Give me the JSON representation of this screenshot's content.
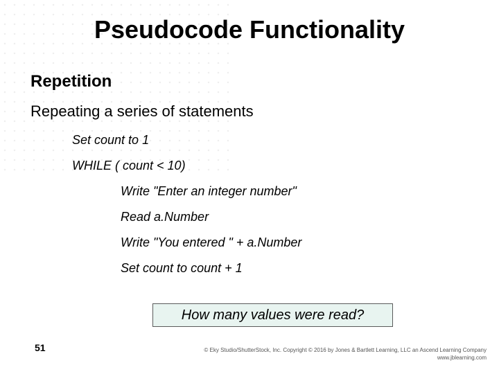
{
  "slide": {
    "title": "Pseudocode Functionality",
    "subhead": "Repetition",
    "lead": "Repeating a series of statements",
    "code": {
      "l1": "Set count to 1",
      "l2": "WHILE ( count < 10)",
      "l3": "Write \"Enter an integer number\"",
      "l4": "Read a.Number",
      "l5": "Write \"You entered \" + a.Number",
      "l6": "Set count to count + 1"
    },
    "callout": "How many values were read?",
    "page_number": "51",
    "copyright_line1": "© Eky Studio/ShutterStock, Inc. Copyright © 2016 by Jones & Bartlett Learning, LLC an Ascend Learning Company",
    "copyright_line2": "www.jblearning.com"
  }
}
